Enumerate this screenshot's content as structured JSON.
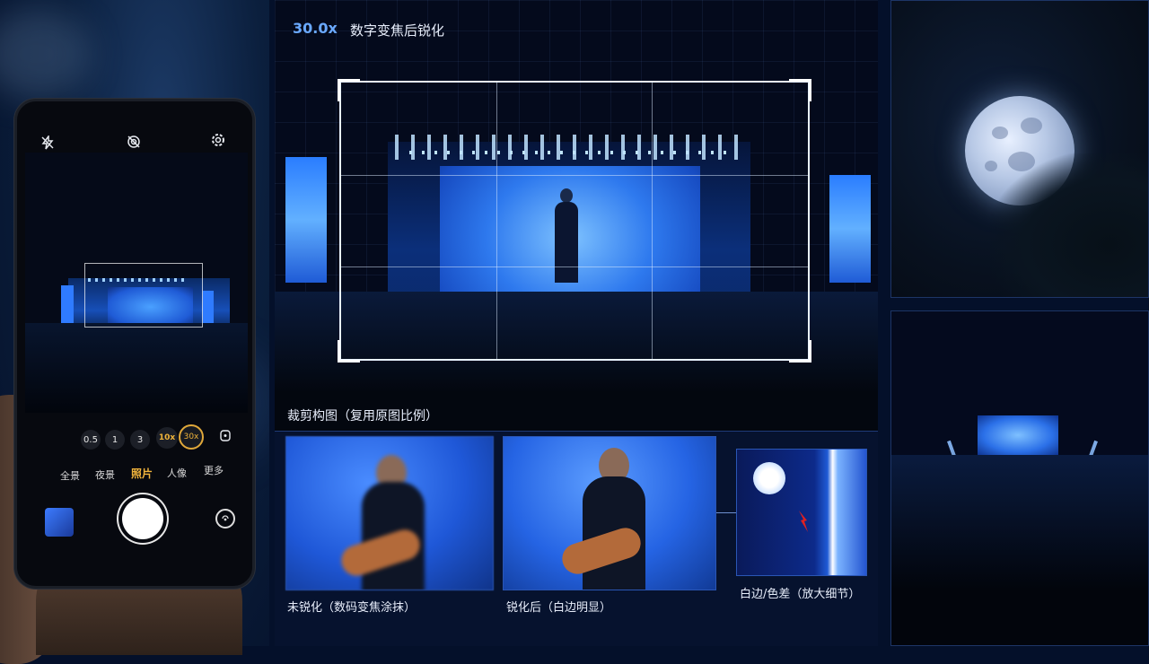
{
  "phone": {
    "icons": {
      "flash": "flash-off-icon",
      "live": "live-photo-off-icon",
      "settings": "gear-icon"
    },
    "zoom_levels": [
      "0.5",
      "1",
      "3",
      "10x",
      "30x"
    ],
    "active_zoom": "30x",
    "modes": [
      "全景",
      "夜景",
      "照片",
      "人像",
      "更多"
    ],
    "active_mode": "照片"
  },
  "center": {
    "zoom_value": "30.0x",
    "zoom_title": "数字变焦后锐化",
    "crop_caption": "裁剪构图（复用原图比例）",
    "captions": {
      "unsharp": "未锐化（数码变焦涂抹）",
      "sharp": "锐化后（白边明显）",
      "detail": "白边/色差（放大细节）"
    }
  },
  "colors": {
    "accent": "#6aa9ff",
    "mode_active": "#f2b53c",
    "stage_blue": "#2e79ee"
  }
}
